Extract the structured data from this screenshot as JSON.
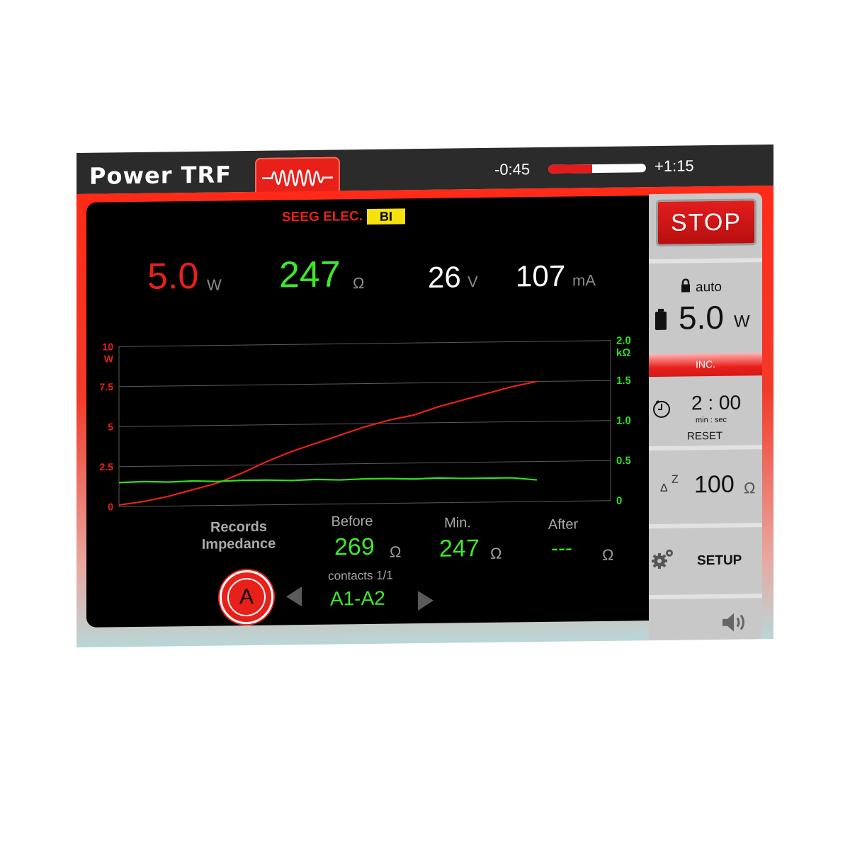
{
  "header": {
    "app_title": "Power TRF",
    "time_left": "-0:45",
    "time_right": "+1:15",
    "progress_elapsed_fraction": 0.45
  },
  "mode": {
    "label": "SEEG ELEC.",
    "badge": "BI"
  },
  "readings": {
    "power": {
      "value": "5.0",
      "unit": "W"
    },
    "impedance": {
      "value": "247",
      "unit": "Ω"
    },
    "voltage": {
      "value": "26",
      "unit": "V"
    },
    "current": {
      "value": "107",
      "unit": "mA"
    }
  },
  "chart_data": {
    "type": "line",
    "left_axis": {
      "unit": "W",
      "ticks": [
        "10",
        "7.5",
        "5",
        "2.5",
        "0"
      ],
      "range": [
        0,
        10
      ]
    },
    "right_axis": {
      "unit": "kΩ",
      "ticks": [
        "2.0",
        "1.5",
        "1.0",
        "0.5",
        "0"
      ],
      "range": [
        0,
        2.0
      ]
    },
    "x_range": [
      0,
      100
    ],
    "series": [
      {
        "color": "#e8201a",
        "axis": "left",
        "x": [
          0,
          5,
          10,
          15,
          20,
          25,
          30,
          35,
          40,
          45,
          50,
          55,
          60,
          65,
          70,
          75,
          80,
          85
        ],
        "values": [
          0.1,
          0.3,
          0.6,
          1.0,
          1.4,
          2.0,
          2.7,
          3.3,
          3.8,
          4.3,
          4.8,
          5.2,
          5.5,
          6.0,
          6.4,
          6.8,
          7.2,
          7.5
        ]
      },
      {
        "color": "#2fe01a",
        "axis": "right",
        "x": [
          0,
          5,
          10,
          15,
          20,
          25,
          30,
          35,
          40,
          45,
          50,
          55,
          60,
          65,
          70,
          75,
          80,
          85
        ],
        "values": [
          0.3,
          0.31,
          0.3,
          0.31,
          0.3,
          0.31,
          0.31,
          0.3,
          0.31,
          0.3,
          0.31,
          0.31,
          0.3,
          0.31,
          0.3,
          0.3,
          0.3,
          0.27
        ]
      }
    ]
  },
  "impedance_records": {
    "label_line1": "Records",
    "label_line2": "Impedance",
    "before": {
      "label": "Before",
      "value": "269",
      "unit": "Ω"
    },
    "min": {
      "label": "Min.",
      "value": "247",
      "unit": "Ω"
    },
    "after": {
      "label": "After",
      "value": "---",
      "unit": "Ω"
    }
  },
  "contacts": {
    "channel_button": "A",
    "counter": "contacts 1/1",
    "pair": "A1-A2"
  },
  "sidebar": {
    "stop_label": "STOP",
    "lock_label": "auto",
    "power_value": "5.0",
    "power_unit": "W",
    "inc_label": "INC.",
    "timer_value": "2 : 00",
    "timer_units": "min : sec",
    "reset_label": "RESET",
    "threshold_value": "100",
    "threshold_unit": "Ω",
    "setup_label": "SETUP"
  },
  "colors": {
    "accent_red": "#e8201a",
    "impedance_green": "#2fe01a",
    "badge_yellow": "#f5e10d"
  }
}
